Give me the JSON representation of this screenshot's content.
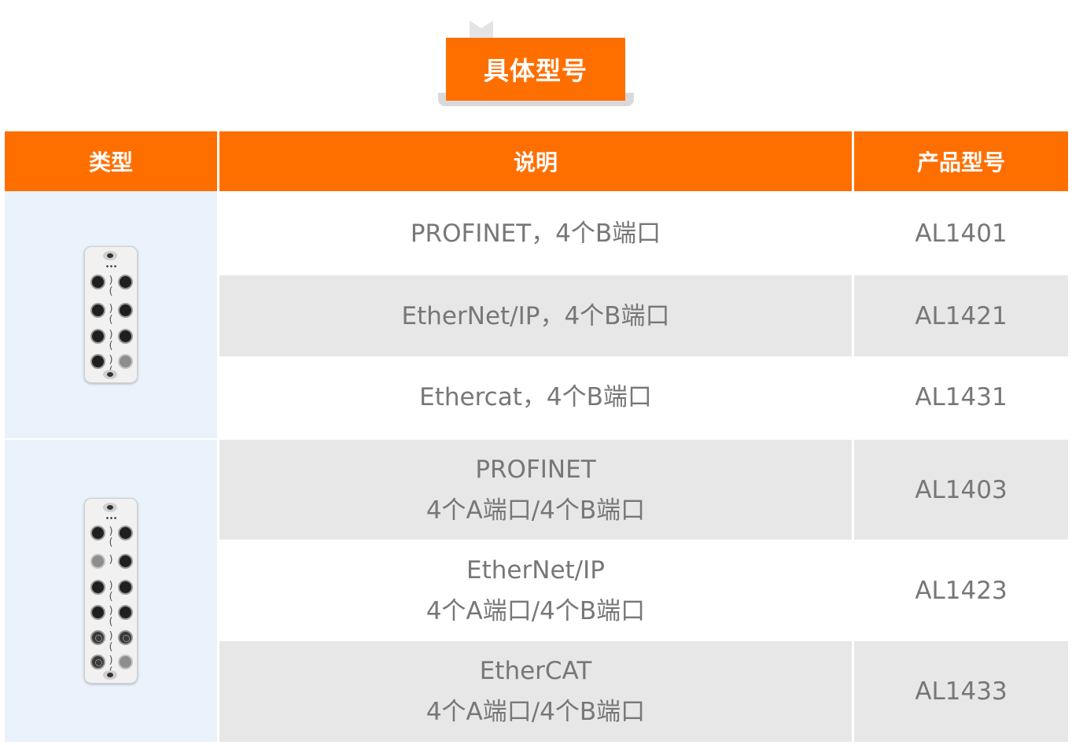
{
  "title": "具体型号",
  "headers": {
    "type": "类型",
    "description": "说明",
    "model": "产品型号"
  },
  "groups": [
    {
      "image_icon": "io-module-4-port-icon",
      "rows": [
        {
          "line1": "PROFINET，4个B端口",
          "line2": "",
          "model": "AL1401"
        },
        {
          "line1": "EtherNet/IP，4个B端口",
          "line2": "",
          "model": "AL1421"
        },
        {
          "line1": "Ethercat，4个B端口",
          "line2": "",
          "model": "AL1431"
        }
      ]
    },
    {
      "image_icon": "io-module-8-port-icon",
      "rows": [
        {
          "line1": "PROFINET",
          "line2": "4个A端口/4个B端口",
          "model": "AL1403"
        },
        {
          "line1": "EtherNet/IP",
          "line2": "4个A端口/4个B端口",
          "model": "AL1423"
        },
        {
          "line1": "EtherCAT",
          "line2": "4个A端口/4个B端口",
          "model": "AL1433"
        }
      ]
    }
  ],
  "colors": {
    "accent": "#ff6f00",
    "text": "#777777",
    "type_bg": "#eaf2fb",
    "row_alt": "#e7e7e7"
  }
}
